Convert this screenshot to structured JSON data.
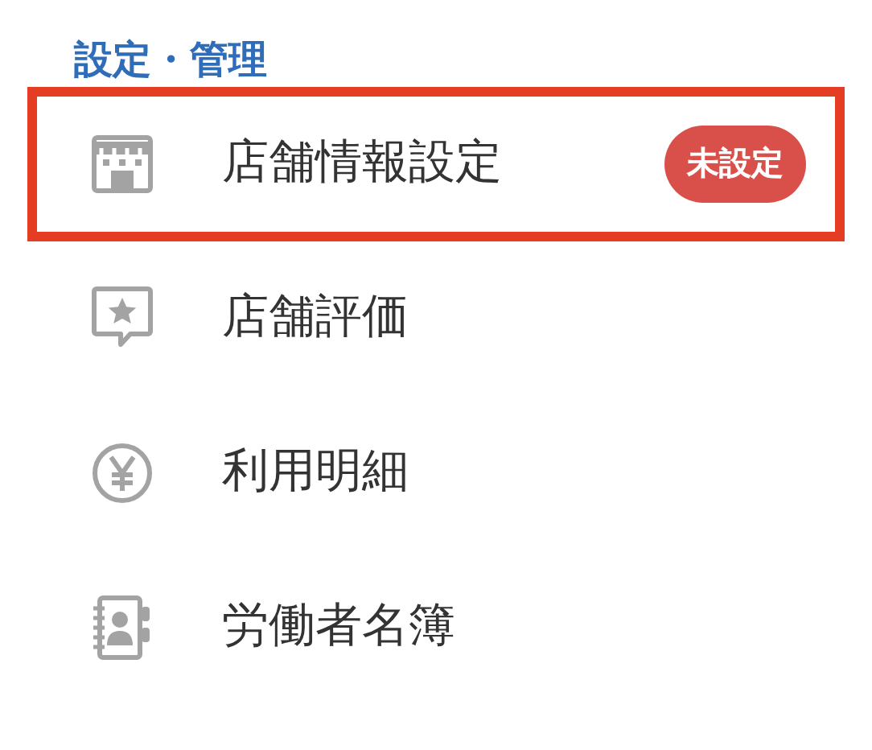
{
  "section_title": "設定・管理",
  "items": [
    {
      "label": "店舗情報設定",
      "badge": "未設定",
      "highlighted": true
    },
    {
      "label": "店舗評価",
      "highlighted": false
    },
    {
      "label": "利用明細",
      "highlighted": false
    },
    {
      "label": "労働者名簿",
      "highlighted": false
    }
  ]
}
